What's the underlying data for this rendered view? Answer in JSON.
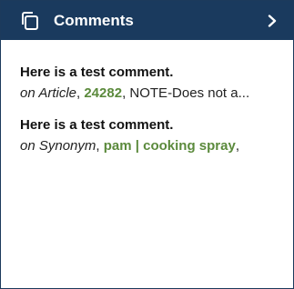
{
  "header": {
    "icon": "comments-copy-icon",
    "title": "Comments",
    "chevron_icon": "chevron-right-icon"
  },
  "comments": [
    {
      "text": "Here is a test comment.",
      "on_prefix": "on",
      "target_type": "Article",
      "separator": ",",
      "link_text": "24282",
      "trailing": ", NOTE-Does not a..."
    },
    {
      "text": "Here is a test comment.",
      "on_prefix": "on",
      "target_type": "Synonym",
      "separator": ",",
      "link_text": "pam | cooking spray",
      "trailing": ","
    }
  ],
  "colors": {
    "header_bg": "#1a3a5e",
    "link": "#5b8a3c"
  }
}
